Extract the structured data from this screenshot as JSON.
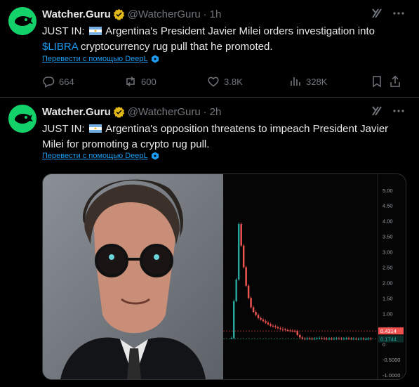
{
  "tweets": [
    {
      "name": "Watcher.Guru",
      "handle": "@WatcherGuru",
      "separator": "·",
      "time": "1h",
      "text_prefix": "JUST IN: ",
      "text_main": " Argentina's President Javier Milei orders investigation into ",
      "cashtag": "$LIBRA",
      "text_suffix": " cryptocurrency rug pull that he promoted.",
      "translate_label": "Перевести с помощью DeepL",
      "replies": "664",
      "reposts": "600",
      "likes": "3.8K",
      "views": "328K"
    },
    {
      "name": "Watcher.Guru",
      "handle": "@WatcherGuru",
      "separator": "·",
      "time": "2h",
      "text_prefix": "JUST IN: ",
      "text_main": " Argentina's opposition threatens to impeach President Javier Milei for promoting a crypto rug pull.",
      "translate_label": "Перевести с помощью DeepL"
    }
  ],
  "icons": {
    "avatar": "watcher-guru-logo",
    "verified": "verified-badge-icon",
    "grok": "grok-icon",
    "more": "more-icon",
    "flag": "argentina-flag-icon",
    "deepl": "deepl-icon",
    "reply": "reply-icon",
    "repost": "repost-icon",
    "like": "heart-icon",
    "views": "views-icon",
    "bookmark": "bookmark-icon",
    "share": "share-icon"
  },
  "colors": {
    "accent": "#1d9bf0",
    "verified": "#e2b719",
    "avatar_bg": "#14d26a",
    "candle_up": "#26a69a",
    "candle_down": "#ef5350"
  },
  "chart_data": {
    "type": "candlestick",
    "y_ticks": [
      "5.00",
      "4.50",
      "4.00",
      "3.50",
      "3.00",
      "2.50",
      "2.00",
      "1.50",
      "1.00",
      "0.50",
      "0",
      "-0.5000",
      "-1.0000"
    ],
    "ylim": [
      -1.0,
      5.2
    ],
    "price_labels": [
      {
        "value": 0.4314,
        "label": "0.4314",
        "color": "#ef5350"
      },
      {
        "value": 0.1744,
        "label": "0.1744",
        "color": "#26a69a"
      }
    ],
    "close_values": [
      0.2,
      1.4,
      2.1,
      3.9,
      3.2,
      2.5,
      1.9,
      1.5,
      1.2,
      1.05,
      0.95,
      0.85,
      0.8,
      0.75,
      0.7,
      0.65,
      0.6,
      0.58,
      0.55,
      0.52,
      0.5,
      0.48,
      0.46,
      0.45,
      0.44,
      0.43,
      0.42,
      0.3,
      0.22,
      0.18,
      0.17,
      0.19,
      0.18,
      0.17,
      0.18,
      0.19,
      0.2,
      0.19,
      0.18,
      0.17,
      0.18,
      0.17,
      0.18,
      0.19,
      0.18,
      0.17,
      0.18,
      0.19,
      0.18,
      0.17,
      0.18,
      0.17,
      0.17,
      0.18,
      0.17,
      0.17,
      0.18,
      0.17
    ]
  }
}
